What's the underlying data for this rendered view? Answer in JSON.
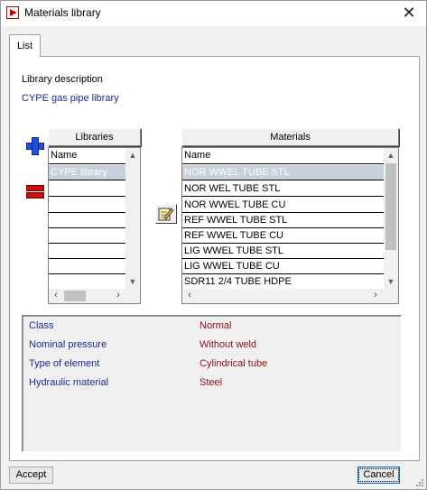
{
  "window": {
    "title": "Materials library",
    "close_glyph": "✕"
  },
  "tabs": [
    {
      "label": "List",
      "active": true
    }
  ],
  "library_description": {
    "label": "Library description",
    "value": "CYPE gas pipe library"
  },
  "libraries": {
    "header": "Libraries",
    "column": "Name",
    "rows": [
      "CYPE library",
      "",
      "",
      "",
      "",
      "",
      "",
      ""
    ],
    "selected_index": 0
  },
  "materials": {
    "header": "Materials",
    "column": "Name",
    "rows": [
      "NOR WWEL TUBE STL",
      "NOR WEL TUBE STL",
      "NOR WWEL TUBE CU",
      "REF WWEL TUBE STL",
      "REF WWEL TUBE CU",
      "LIG WWEL TUBE STL",
      "LIG WWEL TUBE CU",
      "SDR11 2/4 TUBE HDPE"
    ],
    "selected_index": 0
  },
  "icons": {
    "add": "plus-icon",
    "delete": "minus-icon",
    "edit": "edit-icon"
  },
  "properties": [
    {
      "label": "Class",
      "value": "Normal"
    },
    {
      "label": "Nominal pressure",
      "value": "Without weld"
    },
    {
      "label": "Type of element",
      "value": "Cylindrical tube"
    },
    {
      "label": "Hydraulic material",
      "value": "Steel"
    }
  ],
  "buttons": {
    "accept": "Accept",
    "cancel": "Cancel"
  },
  "colors": {
    "label_blue": "#1a2a90",
    "value_red": "#8a1010",
    "selection": "#c8d0dc"
  }
}
